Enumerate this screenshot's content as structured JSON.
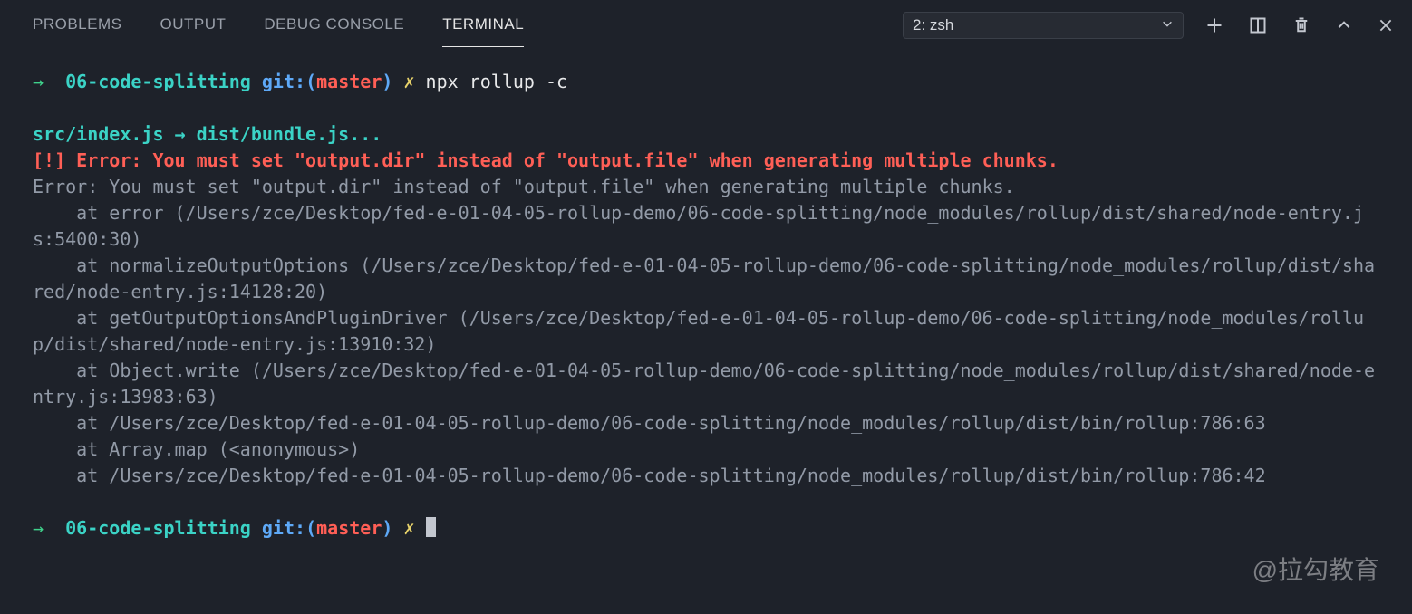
{
  "tabs": {
    "problems": "PROBLEMS",
    "output": "OUTPUT",
    "debug_console": "DEBUG CONSOLE",
    "terminal": "TERMINAL"
  },
  "terminal_select": "2: zsh",
  "prompt": {
    "arrow": "→",
    "cwd": "06-code-splitting",
    "git": "git:",
    "branch": "master",
    "flash": "✗"
  },
  "command": "npx rollup -c",
  "build_line": "src/index.js → dist/bundle.js...",
  "error_bang": "[!] Error: You must set \"output.dir\" instead of \"output.file\" when generating multiple chunks.",
  "trace": [
    "Error: You must set \"output.dir\" instead of \"output.file\" when generating multiple chunks.",
    "    at error (/Users/zce/Desktop/fed-e-01-04-05-rollup-demo/06-code-splitting/node_modules/rollup/dist/shared/node-entry.js:5400:30)",
    "    at normalizeOutputOptions (/Users/zce/Desktop/fed-e-01-04-05-rollup-demo/06-code-splitting/node_modules/rollup/dist/shared/node-entry.js:14128:20)",
    "    at getOutputOptionsAndPluginDriver (/Users/zce/Desktop/fed-e-01-04-05-rollup-demo/06-code-splitting/node_modules/rollup/dist/shared/node-entry.js:13910:32)",
    "    at Object.write (/Users/zce/Desktop/fed-e-01-04-05-rollup-demo/06-code-splitting/node_modules/rollup/dist/shared/node-entry.js:13983:63)",
    "    at /Users/zce/Desktop/fed-e-01-04-05-rollup-demo/06-code-splitting/node_modules/rollup/dist/bin/rollup:786:63",
    "    at Array.map (<anonymous>)",
    "    at /Users/zce/Desktop/fed-e-01-04-05-rollup-demo/06-code-splitting/node_modules/rollup/dist/bin/rollup:786:42"
  ],
  "watermark": "@拉勾教育"
}
